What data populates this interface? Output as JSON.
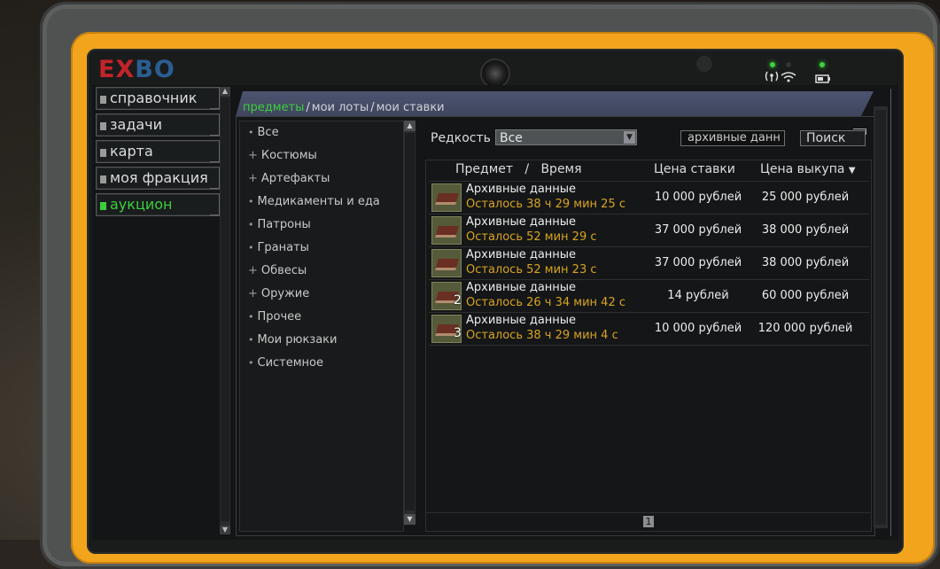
{
  "logo": {
    "part1": "EX",
    "part2": "BO"
  },
  "nav": {
    "items": [
      {
        "label": "справочник",
        "active": false
      },
      {
        "label": "задачи",
        "active": false
      },
      {
        "label": "карта",
        "active": false
      },
      {
        "label": "моя фракция",
        "active": false
      },
      {
        "label": "аукцион",
        "active": true
      }
    ]
  },
  "tabs": {
    "items": [
      {
        "label": "предметы",
        "active": true
      },
      {
        "label": "мои лоты",
        "active": false
      },
      {
        "label": "мои ставки",
        "active": false
      }
    ],
    "separator": "/"
  },
  "categories": [
    {
      "prefix": "•",
      "label": "Все"
    },
    {
      "prefix": "+",
      "label": "Костюмы"
    },
    {
      "prefix": "+",
      "label": "Артефакты"
    },
    {
      "prefix": "•",
      "label": "Медикаменты и еда"
    },
    {
      "prefix": "•",
      "label": "Патроны"
    },
    {
      "prefix": "•",
      "label": "Гранаты"
    },
    {
      "prefix": "+",
      "label": "Обвесы"
    },
    {
      "prefix": "+",
      "label": "Оружие"
    },
    {
      "prefix": "•",
      "label": "Прочее"
    },
    {
      "prefix": "•",
      "label": "Мои рюкзаки"
    },
    {
      "prefix": "•",
      "label": "Системное"
    }
  ],
  "filters": {
    "rarity_label": "Редкость",
    "rarity_value": "Все",
    "search_value": "архивные данн",
    "search_button": "Поиск"
  },
  "table": {
    "header_item_time": "Предмет   /   Время",
    "header_bid": "Цена ставки",
    "header_buyout": "Цена выкупа",
    "sort_icon": "▼",
    "rows": [
      {
        "name": "Архивные данные",
        "time": "Осталось 38 ч 29 мин 25 с",
        "bid": "10 000 рублей",
        "buyout": "25 000 рублей",
        "qty": ""
      },
      {
        "name": "Архивные данные",
        "time": "Осталось 52 мин 29 с",
        "bid": "37 000 рублей",
        "buyout": "38 000 рублей",
        "qty": ""
      },
      {
        "name": "Архивные данные",
        "time": "Осталось 52 мин 23 с",
        "bid": "37 000 рублей",
        "buyout": "38 000 рублей",
        "qty": ""
      },
      {
        "name": "Архивные данные",
        "time": "Осталось 26 ч 34 мин 42 с",
        "bid": "14 рублей",
        "buyout": "60 000 рублей",
        "qty": "2"
      },
      {
        "name": "Архивные данные",
        "time": "Осталось 38 ч 29 мин 4 с",
        "bid": "10 000 рублей",
        "buyout": "120 000 рублей",
        "qty": "3"
      }
    ]
  },
  "pager": {
    "current_page": "1"
  },
  "colors": {
    "accent_green": "#3bcf3b",
    "time_orange": "#d9a421",
    "device_orange": "#f2a51c"
  },
  "icons": {
    "status": [
      "wifi-icon",
      "battery-icon"
    ]
  }
}
